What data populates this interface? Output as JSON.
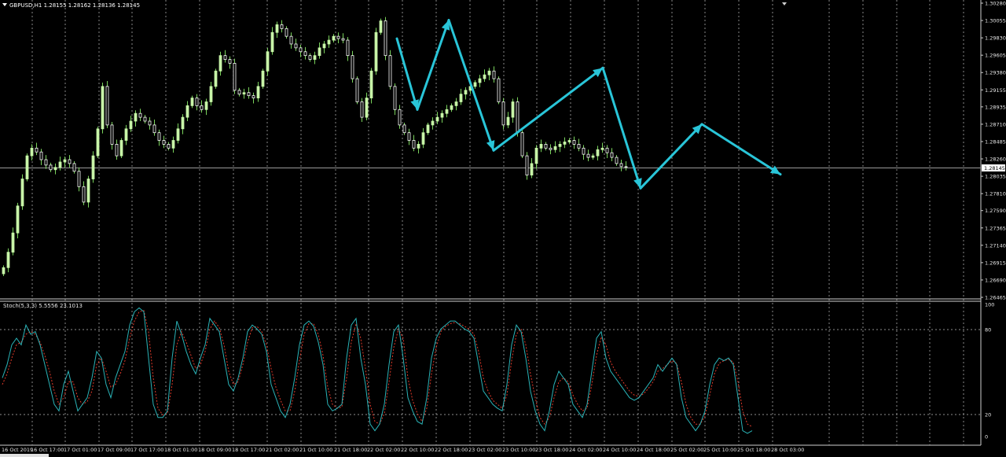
{
  "header": {
    "symbol_line": "GBPUSD,H1  1.28155 1.28162 1.28136 1.28145",
    "stoch_line": "Stoch(5,3,3) 5.5556 23.1013"
  },
  "colors": {
    "background": "#000000",
    "bull_candle": "#c8f5a8",
    "bear_candle": "#ffffff",
    "wick": "#7ad35c",
    "arrow": "#29c5d8",
    "stoch_main": "#2ab3b7",
    "stoch_signal": "#e03a2a",
    "grid": "#c0c0c0",
    "price_box": "#ffffff"
  },
  "chart_data": [
    {
      "type": "candlestick",
      "symbol": "GBPUSD",
      "timeframe": "H1",
      "ylim": [
        1.26465,
        1.3028
      ],
      "y_ticks": [
        "1.30280",
        "1.30055",
        "1.29830",
        "1.29605",
        "1.29380",
        "1.29155",
        "1.28935",
        "1.28710",
        "1.28485",
        "1.28260",
        "1.28035",
        "1.27810",
        "1.27590",
        "1.27365",
        "1.27140",
        "1.26915",
        "1.26690",
        "1.26465"
      ],
      "current_price": "1.28145",
      "x_ticks": [
        "16 Oct 2019",
        "16 Oct 17:00",
        "17 Oct 01:00",
        "17 Oct 09:00",
        "17 Oct 17:00",
        "18 Oct 01:00",
        "18 Oct 09:00",
        "18 Oct 17:00",
        "21 Oct 02:00",
        "21 Oct 10:00",
        "21 Oct 18:00",
        "22 Oct 02:00",
        "22 Oct 10:00",
        "22 Oct 18:00",
        "23 Oct 02:00",
        "23 Oct 10:00",
        "23 Oct 18:00",
        "24 Oct 02:00",
        "24 Oct 10:00",
        "24 Oct 18:00",
        "25 Oct 02:00",
        "25 Oct 10:00",
        "25 Oct 18:00",
        "28 Oct 03:00"
      ],
      "close_path_x": [
        0,
        6,
        12,
        18,
        24,
        30,
        36,
        42,
        48,
        54,
        60,
        66,
        72,
        78,
        84,
        90,
        96,
        102,
        108,
        114,
        120,
        126,
        132,
        138,
        144,
        150,
        156,
        162,
        168,
        174,
        180,
        186,
        192,
        198,
        204,
        210,
        216,
        222,
        228,
        234,
        240,
        246,
        252,
        258,
        264,
        270,
        276,
        282,
        288,
        294,
        300,
        306,
        312,
        318,
        324,
        330,
        336,
        342,
        348,
        354,
        360,
        366,
        372,
        378,
        384,
        390,
        396,
        402,
        408,
        414,
        420,
        426,
        432,
        438,
        444,
        450,
        456,
        462,
        468,
        474,
        480,
        486,
        492,
        498,
        504,
        510,
        516,
        522,
        528,
        534,
        540,
        546,
        552,
        558,
        564,
        570,
        576,
        582,
        588,
        594,
        600,
        606,
        612,
        618,
        624,
        630,
        636,
        642,
        648,
        654,
        660,
        666,
        672,
        678,
        684,
        690,
        696,
        702,
        708,
        714,
        720,
        726,
        732,
        738,
        744,
        750,
        756,
        762,
        768,
        774,
        780,
        786,
        792,
        798,
        804,
        810,
        816,
        822,
        828,
        834,
        840,
        846,
        852,
        858,
        864,
        870,
        876,
        882,
        888,
        894,
        900,
        906,
        912,
        918,
        924,
        930,
        936,
        942,
        948,
        954,
        960,
        966,
        972,
        978,
        984,
        987
      ],
      "close_path_y": [
        1.2685,
        1.2705,
        1.273,
        1.2765,
        1.28,
        1.283,
        1.284,
        1.2835,
        1.2825,
        1.2818,
        1.2812,
        1.2815,
        1.2822,
        1.2825,
        1.282,
        1.281,
        1.279,
        1.277,
        1.28,
        1.283,
        1.2865,
        1.292,
        1.287,
        1.2845,
        1.283,
        1.285,
        1.2865,
        1.2875,
        1.2885,
        1.288,
        1.2875,
        1.287,
        1.286,
        1.285,
        1.2845,
        1.284,
        1.285,
        1.2865,
        1.288,
        1.2895,
        1.2905,
        1.2895,
        1.289,
        1.29,
        1.292,
        1.294,
        1.296,
        1.2955,
        1.295,
        1.2915,
        1.291,
        1.2912,
        1.2908,
        1.2905,
        1.292,
        1.294,
        1.2965,
        1.299,
        1.3,
        1.2995,
        1.2985,
        1.2975,
        1.297,
        1.2965,
        1.296,
        1.2955,
        1.296,
        1.297,
        1.2975,
        1.298,
        1.2985,
        1.2982,
        1.298,
        1.296,
        1.293,
        1.29,
        1.288,
        1.2905,
        1.294,
        1.299,
        1.3005,
        1.296,
        1.292,
        1.289,
        1.287,
        1.286,
        1.285,
        1.284,
        1.2845,
        1.286,
        1.287,
        1.2875,
        1.288,
        1.2885,
        1.289,
        1.2895,
        1.29,
        1.291,
        1.2915,
        1.292,
        1.2925,
        1.293,
        1.2935,
        1.294,
        1.293,
        1.29,
        1.287,
        1.288,
        1.29,
        1.286,
        1.283,
        1.2805,
        1.282,
        1.284,
        1.2845,
        1.284,
        1.2838,
        1.2842,
        1.2845,
        1.2848,
        1.285,
        1.2845,
        1.284,
        1.2832,
        1.2828,
        1.283,
        1.2838,
        1.284,
        1.2834,
        1.2828,
        1.282,
        1.2816,
        1.2815
      ],
      "arrows": [
        {
          "from": [
            505,
            1.2982
          ],
          "to": [
            531,
            1.289
          ]
        },
        {
          "from": [
            531,
            1.289
          ],
          "to": [
            571,
            1.3006
          ]
        },
        {
          "from": [
            571,
            1.3006
          ],
          "to": [
            628,
            1.2837
          ]
        },
        {
          "from": [
            628,
            1.2837
          ],
          "to": [
            767,
            1.2944
          ]
        },
        {
          "from": [
            767,
            1.2944
          ],
          "to": [
            815,
            1.2788
          ]
        },
        {
          "from": [
            815,
            1.2788
          ],
          "to": [
            893,
            1.2871
          ]
        },
        {
          "from": [
            893,
            1.2871
          ],
          "to": [
            993,
            1.2806
          ]
        }
      ]
    },
    {
      "type": "line",
      "name": "Stoch(5,3,3)",
      "ylim": [
        0,
        100
      ],
      "y_ticks": [
        "100",
        "80",
        "20",
        "0"
      ],
      "levels": [
        80,
        20
      ],
      "x": [
        0,
        6,
        12,
        18,
        24,
        30,
        36,
        42,
        48,
        54,
        60,
        66,
        72,
        78,
        84,
        90,
        96,
        102,
        108,
        114,
        120,
        126,
        132,
        138,
        144,
        150,
        156,
        162,
        168,
        174,
        180,
        186,
        192,
        198,
        204,
        210,
        216,
        222,
        228,
        234,
        240,
        246,
        252,
        258,
        264,
        270,
        276,
        282,
        288,
        294,
        300,
        306,
        312,
        318,
        324,
        330,
        336,
        342,
        348,
        354,
        360,
        366,
        372,
        378,
        384,
        390,
        396,
        402,
        408,
        414,
        420,
        426,
        432,
        438,
        444,
        450,
        456,
        462,
        468,
        474,
        480,
        486,
        492,
        498,
        504,
        510,
        516,
        522,
        528,
        534,
        540,
        546,
        552,
        558,
        564,
        570,
        576,
        582,
        588,
        594,
        600,
        606,
        612,
        618,
        624,
        630,
        636,
        642,
        648,
        654,
        660,
        666,
        672,
        678,
        684,
        690,
        696,
        702,
        708,
        714,
        720,
        726,
        732,
        738,
        744,
        750,
        756,
        762,
        768,
        774,
        780,
        786,
        792,
        798,
        804,
        810,
        816,
        822,
        828,
        834,
        840,
        846,
        852,
        858,
        864,
        870,
        876,
        882,
        888,
        894,
        900,
        906,
        912,
        918,
        924,
        930,
        936,
        942,
        948,
        954,
        960,
        966,
        972,
        978,
        984,
        990
      ],
      "series": [
        {
          "values": [
            45,
            55,
            70,
            75,
            70,
            85,
            78,
            80,
            70,
            55,
            40,
            25,
            20,
            40,
            50,
            35,
            20,
            25,
            30,
            45,
            65,
            60,
            40,
            30,
            45,
            55,
            65,
            85,
            95,
            98,
            95,
            60,
            25,
            15,
            15,
            20,
            60,
            88,
            78,
            65,
            55,
            48,
            60,
            70,
            90,
            85,
            80,
            60,
            40,
            35,
            45,
            60,
            80,
            85,
            82,
            78,
            65,
            40,
            30,
            20,
            15,
            25,
            45,
            70,
            85,
            88,
            84,
            72,
            55,
            25,
            20,
            22,
            25,
            60,
            85,
            90,
            60,
            40,
            10,
            5,
            10,
            25,
            55,
            80,
            85,
            60,
            30,
            20,
            12,
            10,
            30,
            60,
            75,
            82,
            85,
            88,
            88,
            85,
            82,
            80,
            75,
            55,
            35,
            30,
            25,
            22,
            20,
            40,
            70,
            85,
            80,
            60,
            35,
            20,
            10,
            5,
            20,
            40,
            50,
            45,
            40,
            25,
            20,
            15,
            25,
            50,
            75,
            80,
            60,
            50,
            45,
            40,
            35,
            30,
            28,
            30,
            35,
            40,
            45,
            55,
            50,
            55,
            60,
            55,
            30,
            15,
            10,
            5,
            10,
            20,
            40,
            55,
            60,
            58,
            60,
            55,
            30,
            5,
            3,
            5
          ]
        },
        {
          "values": [
            40,
            48,
            60,
            70,
            72,
            78,
            80,
            78,
            72,
            62,
            50,
            35,
            25,
            30,
            42,
            42,
            30,
            25,
            27,
            35,
            55,
            60,
            50,
            38,
            40,
            48,
            58,
            75,
            88,
            95,
            96,
            80,
            45,
            22,
            17,
            18,
            40,
            70,
            80,
            72,
            62,
            52,
            55,
            65,
            82,
            88,
            83,
            70,
            50,
            40,
            42,
            55,
            72,
            83,
            84,
            80,
            70,
            52,
            38,
            28,
            20,
            20,
            35,
            58,
            78,
            86,
            86,
            78,
            62,
            38,
            25,
            22,
            23,
            45,
            72,
            86,
            75,
            52,
            25,
            12,
            10,
            18,
            42,
            68,
            82,
            75,
            45,
            28,
            18,
            12,
            22,
            48,
            68,
            80,
            84,
            86,
            87,
            86,
            84,
            82,
            78,
            65,
            45,
            35,
            28,
            25,
            22,
            32,
            58,
            78,
            82,
            70,
            48,
            30,
            15,
            10,
            15,
            30,
            42,
            45,
            42,
            32,
            25,
            20,
            22,
            40,
            62,
            76,
            70,
            57,
            50,
            45,
            40,
            35,
            32,
            31,
            33,
            37,
            42,
            50,
            52,
            55,
            58,
            56,
            42,
            25,
            15,
            10,
            10,
            16,
            32,
            48,
            56,
            58,
            59,
            57,
            42,
            20,
            10,
            8
          ]
        }
      ]
    }
  ]
}
